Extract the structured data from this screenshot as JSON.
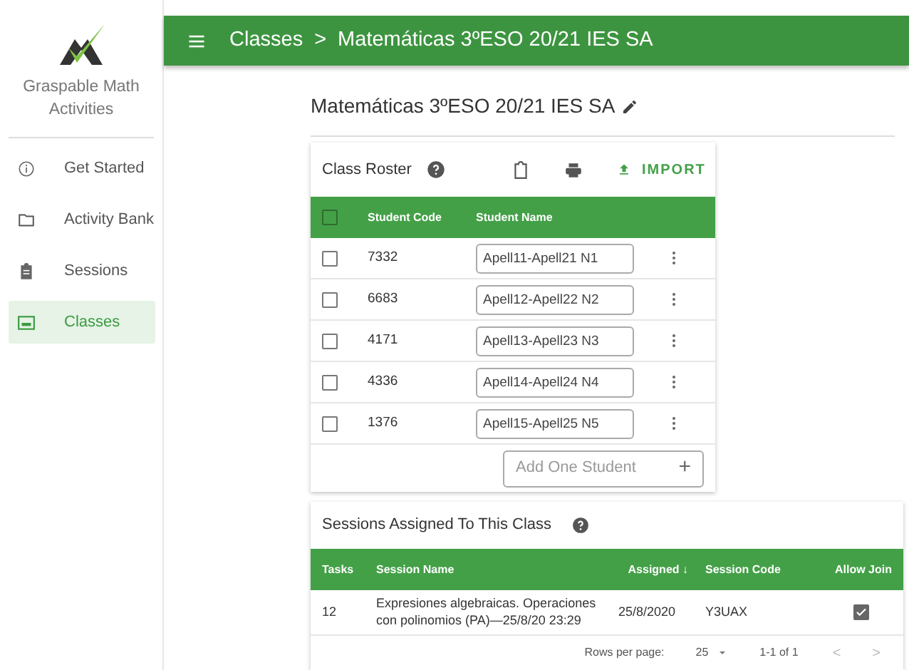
{
  "sidebar": {
    "app_name": "Graspable Math Activities",
    "items": [
      {
        "label": "Get Started",
        "selected": false
      },
      {
        "label": "Activity Bank",
        "selected": false
      },
      {
        "label": "Sessions",
        "selected": false
      },
      {
        "label": "Classes",
        "selected": true
      }
    ]
  },
  "top_bar": {
    "breadcrumb": [
      "Classes",
      "Matemáticas 3ºESO 20/21 IES SA"
    ],
    "separator": ">"
  },
  "class_title": "Matemáticas 3ºESO 20/21 IES SA",
  "roster": {
    "title": "Class Roster",
    "import_label": "IMPORT",
    "select_all_checked": false,
    "columns": [
      "Student Code",
      "Student Name"
    ],
    "rows": [
      {
        "code": "7332",
        "name": "Apell11-Apell21 N1",
        "checked": false
      },
      {
        "code": "6683",
        "name": "Apell12-Apell22 N2",
        "checked": false
      },
      {
        "code": "4171",
        "name": "Apell13-Apell23 N3",
        "checked": false
      },
      {
        "code": "4336",
        "name": "Apell14-Apell24 N4",
        "checked": false
      },
      {
        "code": "1376",
        "name": "Apell15-Apell25 N5",
        "checked": false
      }
    ],
    "add_placeholder": "Add One Student",
    "add_symbol": "+"
  },
  "sessions": {
    "title": "Sessions Assigned To This Class",
    "columns": [
      "Tasks",
      "Session Name",
      "Assigned ↓",
      "Session Code",
      "Allow Join"
    ],
    "rows": [
      {
        "tasks": "12",
        "name": "Expresiones algebraicas. Operaciones con polinomios (PA)—25/8/20 23:29",
        "assigned": "25/8/2020",
        "code": "Y3UAX",
        "allow_join": true
      }
    ],
    "footer": {
      "rows_per_page_label": "Rows per page:",
      "rows_per_page": "25",
      "range": "1-1 of 1",
      "prev": "<",
      "next": ">"
    }
  }
}
